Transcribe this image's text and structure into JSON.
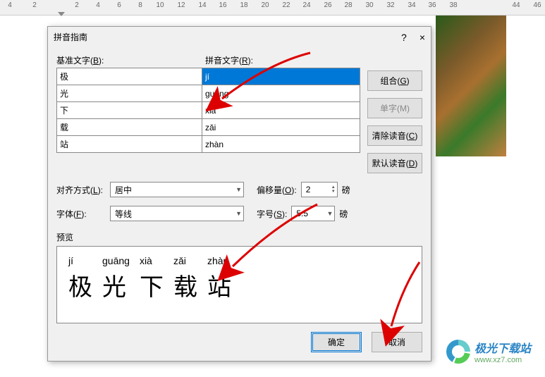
{
  "ruler": {
    "numbers": [
      4,
      2,
      2,
      4,
      6,
      8,
      10,
      12,
      14,
      16,
      18,
      20,
      22,
      24,
      26,
      28,
      30,
      32,
      34,
      36,
      38,
      44,
      46
    ]
  },
  "dialog": {
    "title": "拼音指南",
    "help": "?",
    "close": "×",
    "labels": {
      "base_text": "基准文字(",
      "base_hotkey": "B",
      "base_text_end": "):",
      "pinyin_text": "拼音文字(",
      "pinyin_hotkey": "R",
      "pinyin_text_end": "):",
      "align": "对齐方式(",
      "align_hotkey": "L",
      "align_end": "):",
      "font": "字体(",
      "font_hotkey": "F",
      "font_end": "):",
      "offset": "偏移量(",
      "offset_hotkey": "O",
      "offset_end": "):",
      "fontsize": "字号(",
      "fontsize_hotkey": "S",
      "fontsize_end": "):",
      "point": "磅",
      "preview": "预览"
    },
    "rows": [
      {
        "base": "极",
        "pinyin": "jí"
      },
      {
        "base": "光",
        "pinyin": "guāng"
      },
      {
        "base": "下",
        "pinyin": "xià"
      },
      {
        "base": "载",
        "pinyin": "zǎi"
      },
      {
        "base": "站",
        "pinyin": "zhàn"
      }
    ],
    "buttons": {
      "combine": "组合(",
      "combine_hk": "G",
      "combine_end": ")",
      "single": "单字(M)",
      "clear": "清除读音(",
      "clear_hk": "C",
      "clear_end": ")",
      "default": "默认读音(",
      "default_hk": "D",
      "default_end": ")",
      "ok": "确定",
      "cancel": "取消"
    },
    "values": {
      "align": "居中",
      "font": "等线",
      "offset": "2",
      "fontsize": "5.5"
    },
    "preview": {
      "pinyin": [
        "jí",
        "guāng",
        "xià",
        "zǎi",
        "zhàn"
      ],
      "hanzi": [
        "极",
        "光",
        "下",
        "载",
        "站"
      ]
    }
  },
  "watermark": {
    "name": "极光下载站",
    "url": "www.xz7.com"
  }
}
